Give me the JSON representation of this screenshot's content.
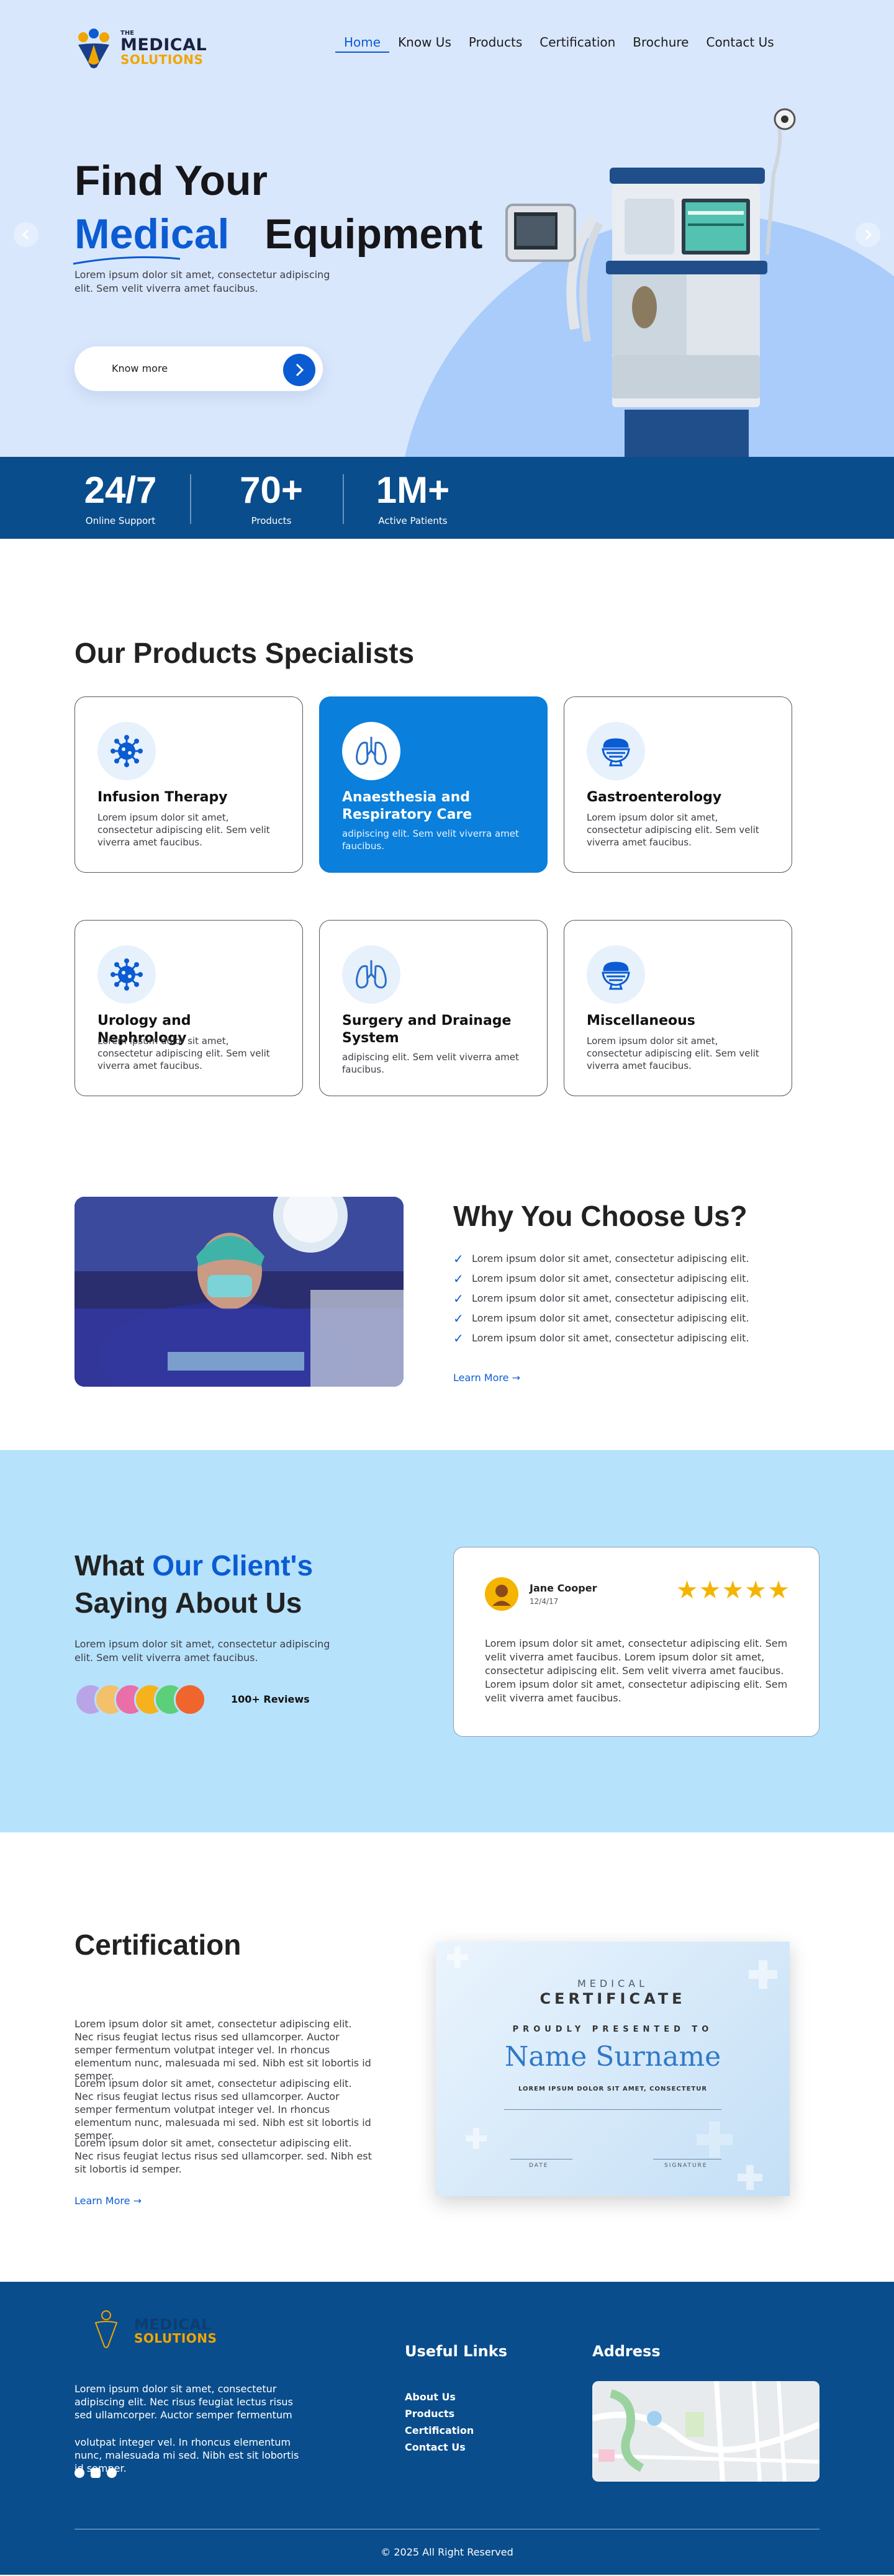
{
  "brand": {
    "the": "THE",
    "word1": "MEDICAL",
    "word2": "SOLUTIONS"
  },
  "nav": [
    "Home",
    "Know Us",
    "Products",
    "Certification",
    "Brochure",
    "Contact Us"
  ],
  "hero": {
    "line1": "Find Your",
    "blue": "Medical",
    "rest": "Equipment",
    "sub": "Lorem ipsum dolor sit amet, consectetur adipiscing elit. Sem velit viverra amet faucibus.",
    "button": "Know more"
  },
  "stats": [
    {
      "value": "24/7",
      "label": "Online Support"
    },
    {
      "value": "70+",
      "label": "Products"
    },
    {
      "value": "1M+",
      "label": "Active Patients"
    }
  ],
  "products": {
    "title": "Our Products Specialists",
    "cards": [
      {
        "title": "Infusion Therapy",
        "text": "Lorem ipsum dolor sit amet, consectetur adipiscing elit. Sem velit viverra amet faucibus.",
        "icon": "virus-icon"
      },
      {
        "title": "Anaesthesia and Respiratory Care",
        "text": "adipiscing elit. Sem velit viverra amet faucibus.",
        "icon": "lungs-icon"
      },
      {
        "title": "Gastroenterology",
        "text": "Lorem ipsum dolor sit amet, consectetur adipiscing elit. Sem velit viverra amet faucibus.",
        "icon": "stomach-icon"
      },
      {
        "title": "Urology and Nephrology",
        "text": "Lorem ipsum dolor sit amet, consectetur adipiscing elit. Sem velit viverra amet faucibus.",
        "icon": "virus-icon"
      },
      {
        "title": "Surgery and Drainage System",
        "text": "adipiscing elit. Sem velit viverra amet faucibus.",
        "icon": "lungs-icon"
      },
      {
        "title": "Miscellaneous",
        "text": "Lorem ipsum dolor sit amet, consectetur adipiscing elit. Sem velit viverra amet faucibus.",
        "icon": "stomach-icon"
      }
    ]
  },
  "why": {
    "title": "Why You Choose Us?",
    "points": [
      "Lorem ipsum dolor sit amet, consectetur adipiscing elit.",
      "Lorem ipsum dolor sit amet, consectetur adipiscing elit.",
      "Lorem ipsum dolor sit amet, consectetur adipiscing elit.",
      "Lorem ipsum dolor sit amet, consectetur adipiscing elit.",
      "Lorem ipsum dolor sit amet, consectetur adipiscing elit."
    ],
    "link": "Learn More"
  },
  "testimonials": {
    "title1": "What",
    "title_blue": "Our Client's",
    "title2": "Saying About Us",
    "sub": "Lorem ipsum dolor sit amet, consectetur adipiscing elit. Sem velit viverra amet faucibus.",
    "reviews": "100+ Reviews",
    "card": {
      "name": "Jane Cooper",
      "date": "12/4/17",
      "stars": "★★★★★",
      "text": "Lorem ipsum dolor sit amet, consectetur adipiscing elit. Sem velit viverra amet faucibus. Lorem ipsum dolor sit amet, consectetur adipiscing elit. Sem velit viverra amet faucibus. Lorem ipsum dolor sit amet, consectetur adipiscing elit. Sem velit viverra amet faucibus."
    }
  },
  "certification": {
    "title": "Certification",
    "paras": [
      "Lorem ipsum dolor sit amet, consectetur adipiscing elit. Nec risus feugiat lectus risus sed ullamcorper. Auctor semper fermentum volutpat integer vel. In rhoncus elementum nunc, malesuada mi sed. Nibh est sit lobortis id semper.",
      "Lorem ipsum dolor sit amet, consectetur adipiscing elit. Nec risus feugiat lectus risus sed ullamcorper. Auctor semper fermentum volutpat integer vel. In rhoncus elementum nunc, malesuada mi sed. Nibh est sit lobortis id semper.",
      "Lorem ipsum dolor sit amet, consectetur adipiscing elit. Nec risus feugiat lectus risus sed ullamcorper. sed. Nibh est sit lobortis id semper."
    ],
    "link": "Learn More",
    "certificate": {
      "top": "MEDICAL",
      "heading": "CERTIFICATE",
      "presented": "PROUDLY PRESENTED TO",
      "name": "Name Surname",
      "line": "LOREM IPSUM DOLOR SIT AMET, CONSECTETUR",
      "date": "DATE",
      "sign": "SIGNATURE"
    }
  },
  "footer": {
    "text1": "Lorem ipsum dolor sit amet, consectetur adipiscing elit. Nec risus feugiat lectus risus sed ullamcorper. Auctor semper fermentum",
    "text2": "volutpat integer vel. In rhoncus elementum nunc, malesuada mi sed. Nibh est sit lobortis id semper.",
    "useful_title": "Useful Links",
    "links": [
      "About Us",
      "Products",
      "Certification",
      "Contact Us"
    ],
    "address_title": "Address",
    "copyright": "© 2025 All Right Reserved"
  },
  "colors": {
    "primary": "#0b5bd3",
    "navy": "#0a4d8c",
    "card_active": "#0a7fdb",
    "sky": "#b6e2fc",
    "gold": "#f0a500"
  }
}
